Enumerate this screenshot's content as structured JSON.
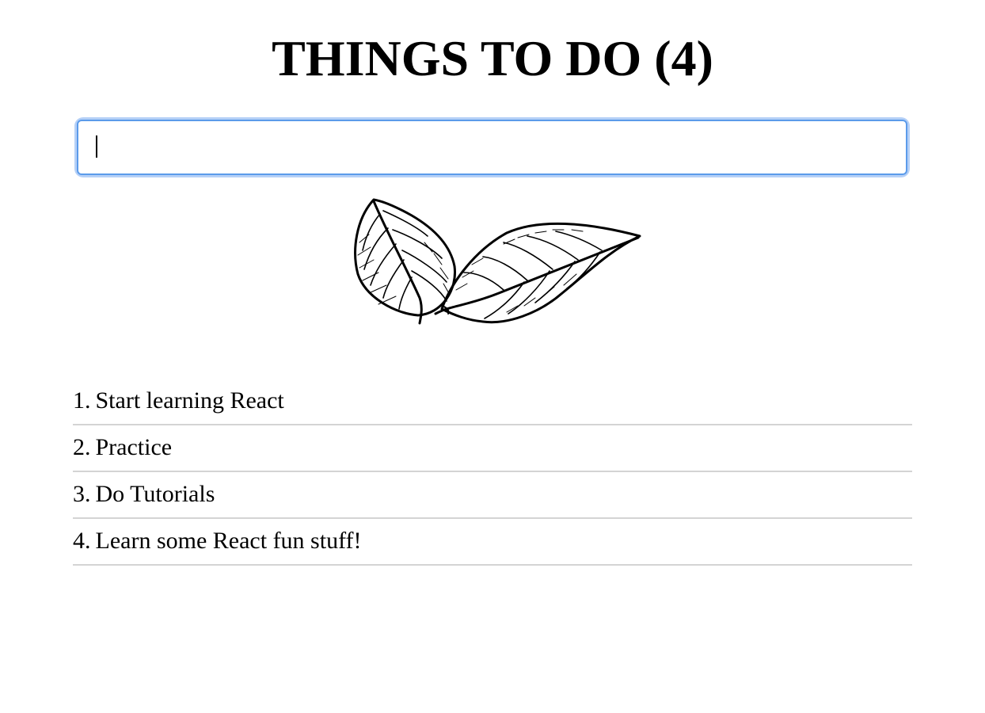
{
  "header": {
    "title": "THINGS TO DO (4)"
  },
  "new_todo": {
    "value": "",
    "placeholder": ""
  },
  "illustration": {
    "icon": "leaves-icon"
  },
  "todos": [
    {
      "number": "1.",
      "text": "Start learning React"
    },
    {
      "number": "2.",
      "text": "Practice"
    },
    {
      "number": "3.",
      "text": "Do Tutorials"
    },
    {
      "number": "4.",
      "text": "Learn some React fun stuff!"
    }
  ],
  "colors": {
    "focus_ring": "#5b9bea",
    "divider": "#d4d4d4"
  }
}
